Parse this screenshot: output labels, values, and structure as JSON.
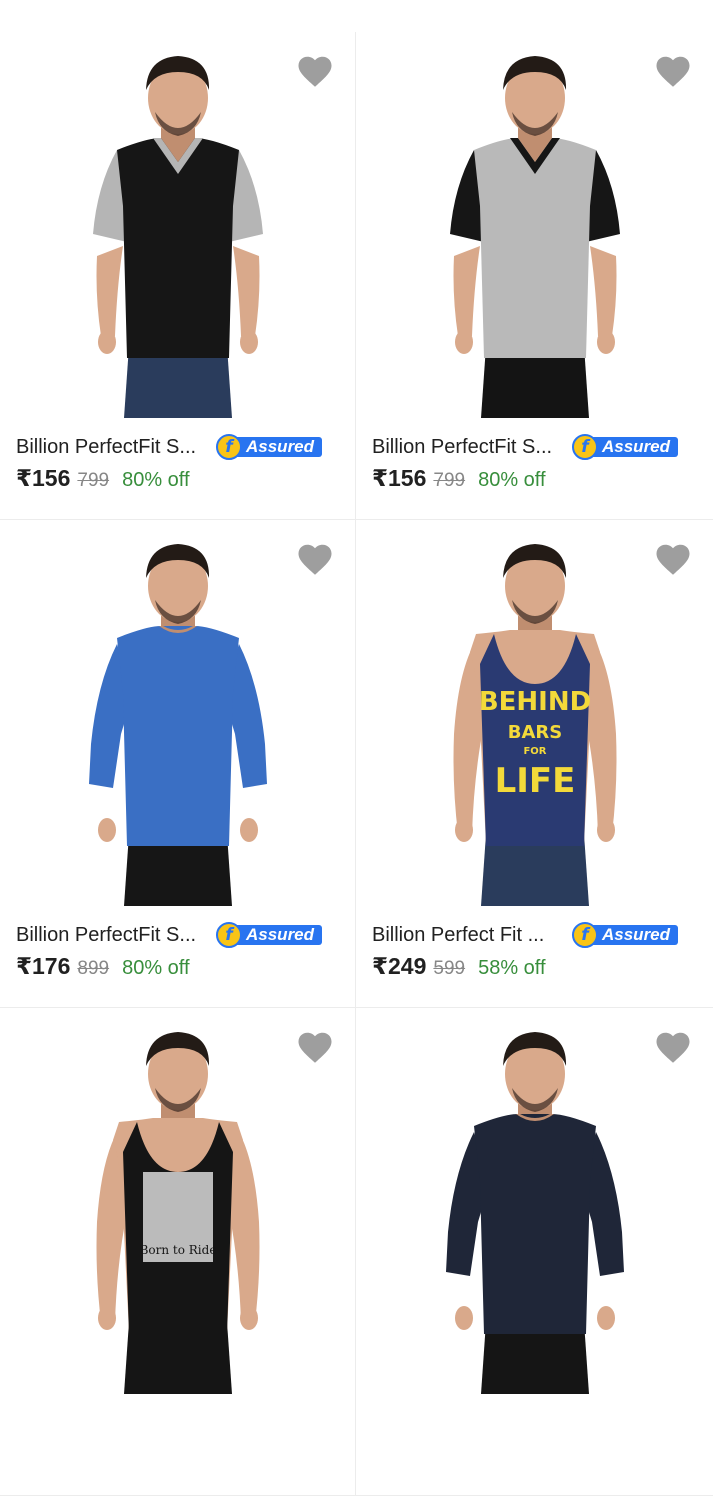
{
  "colors": {
    "accent_blue": "#2874f0",
    "badge_yellow": "#f9c416",
    "discount_green": "#388e3c",
    "mrp_grey": "#878787",
    "wishlist_grey": "#9e9e9e"
  },
  "products": [
    {
      "title": "Billion PerfectFit S...",
      "assured_label": "Assured",
      "price": "₹156",
      "mrp": "799",
      "discount": "80% off",
      "image": {
        "style": "vneck",
        "body_color": "#161616",
        "sleeve_color": "#b5b5b5",
        "neck_color": "#b5b5b5",
        "pants_color": "#2a3c5c"
      }
    },
    {
      "title": "Billion PerfectFit S...",
      "assured_label": "Assured",
      "price": "₹156",
      "mrp": "799",
      "discount": "80% off",
      "image": {
        "style": "vneck",
        "body_color": "#b9b9b9",
        "sleeve_color": "#161616",
        "neck_color": "#161616",
        "pants_color": "#141414"
      }
    },
    {
      "title": "Billion PerfectFit S...",
      "assured_label": "Assured",
      "price": "₹176",
      "mrp": "899",
      "discount": "80% off",
      "image": {
        "style": "fullsleeve",
        "body_color": "#3a6fc4",
        "sleeve_color": "#3a6fc4",
        "neck_color": "#3a6fc4",
        "pants_color": "#161616"
      }
    },
    {
      "title": "Billion Perfect Fit ...",
      "assured_label": "Assured",
      "price": "₹249",
      "mrp": "599",
      "discount": "58% off",
      "image": {
        "style": "vest",
        "body_color": "#2a3a72",
        "sleeve_color": "#2a3a72",
        "neck_color": "#2a3a72",
        "pants_color": "#2a3c5c"
      }
    },
    {
      "title": "",
      "assured_label": "",
      "price": "",
      "mrp": "",
      "discount": "",
      "image": {
        "style": "vest",
        "body_color": "#151515",
        "sleeve_color": "#151515",
        "neck_color": "#151515",
        "pants_color": "#151515"
      }
    },
    {
      "title": "",
      "assured_label": "",
      "price": "",
      "mrp": "",
      "discount": "",
      "image": {
        "style": "fullsleeve",
        "body_color": "#1f2638",
        "sleeve_color": "#1f2638",
        "neck_color": "#1f2638",
        "pants_color": "#151515"
      }
    }
  ],
  "icons": {
    "wishlist": "heart-icon",
    "assured": "flipkart-f-icon"
  },
  "print_text": {
    "vest_1": [
      "BEHIND",
      "BARS",
      "FOR",
      "LIFE"
    ],
    "vest_2": "Born to Ride"
  }
}
